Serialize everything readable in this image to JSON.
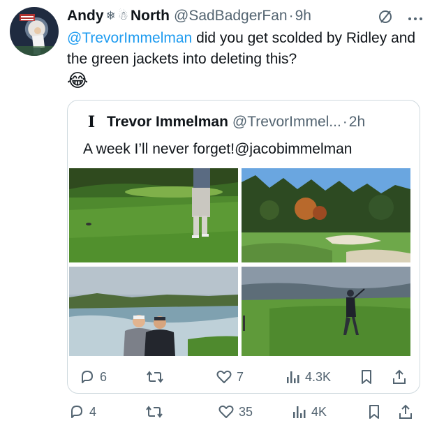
{
  "outer_tweet": {
    "author_name_first": "Andy",
    "author_emoji_1": "❄",
    "author_emoji_2": "☃",
    "author_name_last": "North",
    "handle": "@SadBadgerFan",
    "separator": "·",
    "time": "9h",
    "mention": "@TrevorImmelman",
    "text": " did you get scolded by Ridley and the green jackets into deleting this?",
    "emoji_line": "😂",
    "actions": {
      "replies": "4",
      "retweets": "",
      "likes": "35",
      "views": "4K"
    }
  },
  "quoted_tweet": {
    "logo_glyph": "I",
    "author_name": "Trevor Immelman",
    "handle": "@TrevorImmel...",
    "separator": "·",
    "time": "2h",
    "text": "A week I’ll never forget!@jacobimmelman",
    "actions": {
      "replies": "6",
      "retweets": "",
      "likes": "7",
      "views": "4.3K"
    }
  },
  "icons": [
    "slash-circle-icon",
    "more-icon",
    "reply-icon",
    "retweet-icon",
    "like-icon",
    "views-icon",
    "bookmark-icon",
    "share-icon"
  ],
  "colors": {
    "link": "#1d9bf0",
    "secondary_text": "#536471",
    "border": "#cfd9de"
  }
}
